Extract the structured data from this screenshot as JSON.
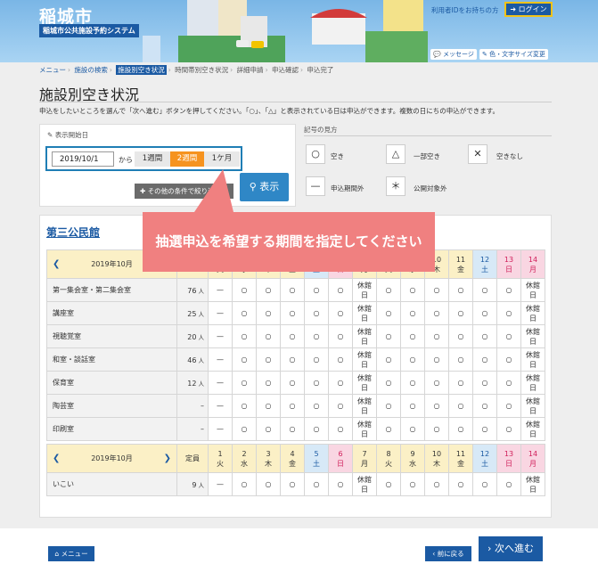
{
  "header": {
    "city_name": "稲城市",
    "system_name": "稲城市公共施設予約システム",
    "user_id_note": "利用者IDをお持ちの方",
    "login_label": "ログイン",
    "message_label": "メッセージ",
    "color_font_label": "色・文字サイズ変更"
  },
  "breadcrumb": {
    "items": [
      "メニュー",
      "施設の検索",
      "施設別空き状況",
      "時間帯別空き状況",
      "詳細申請",
      "申込確認",
      "申込完了"
    ]
  },
  "page": {
    "title": "施設別空き状況",
    "intro": "申込をしたいところを選んで「次へ進む」ボタンを押してください。「○」、「△」と表示されている日は申込ができます。複数の日にちの申込ができます。"
  },
  "start_panel": {
    "label": "表示開始日",
    "date_value": "2019/10/1",
    "kara": "から",
    "period_options": [
      "1週間",
      "2週間",
      "1ケ月"
    ],
    "selected_period": "2週間",
    "other_conditions": "その他の条件で絞り込む",
    "show_button": "表示"
  },
  "legend": {
    "title": "記号の見方",
    "items": [
      {
        "symbol": "○",
        "label": "空き"
      },
      {
        "symbol": "△",
        "label": "一部空き"
      },
      {
        "symbol": "✕",
        "label": "空きなし"
      },
      {
        "symbol": "—",
        "label": "申込期間外"
      },
      {
        "symbol": "＊",
        "label": "公開対象外"
      }
    ]
  },
  "callout": {
    "text": "抽選申込を希望する期間を指定してください"
  },
  "facility": {
    "name": "第三公民館",
    "month_label": "2019年10月",
    "capacity_header": "定員",
    "days": [
      {
        "d": "1",
        "w": "火",
        "t": "wk"
      },
      {
        "d": "2",
        "w": "水",
        "t": "wk"
      },
      {
        "d": "3",
        "w": "木",
        "t": "wk"
      },
      {
        "d": "4",
        "w": "金",
        "t": "wk"
      },
      {
        "d": "5",
        "w": "土",
        "t": "sat"
      },
      {
        "d": "6",
        "w": "日",
        "t": "sun"
      },
      {
        "d": "7",
        "w": "月",
        "t": "wk"
      },
      {
        "d": "8",
        "w": "火",
        "t": "wk"
      },
      {
        "d": "9",
        "w": "水",
        "t": "wk"
      },
      {
        "d": "10",
        "w": "木",
        "t": "wk"
      },
      {
        "d": "11",
        "w": "金",
        "t": "wk"
      },
      {
        "d": "12",
        "w": "土",
        "t": "sat"
      },
      {
        "d": "13",
        "w": "日",
        "t": "sun"
      },
      {
        "d": "14",
        "w": "月",
        "t": "sun"
      }
    ],
    "closed_label": "休館日",
    "rooms1": [
      {
        "name": "第一集会室・第二集会室",
        "cap": "76",
        "unit": "人",
        "cells": [
          "—",
          "○",
          "○",
          "○",
          "○",
          "○",
          "休館日",
          "○",
          "○",
          "○",
          "○",
          "○",
          "○",
          "休館日"
        ]
      },
      {
        "name": "講座室",
        "cap": "25",
        "unit": "人",
        "cells": [
          "—",
          "○",
          "○",
          "○",
          "○",
          "○",
          "休館日",
          "○",
          "○",
          "○",
          "○",
          "○",
          "○",
          "休館日"
        ]
      },
      {
        "name": "視聴覚室",
        "cap": "20",
        "unit": "人",
        "cells": [
          "—",
          "○",
          "○",
          "○",
          "○",
          "○",
          "休館日",
          "○",
          "○",
          "○",
          "○",
          "○",
          "○",
          "休館日"
        ]
      },
      {
        "name": "和室・談話室",
        "cap": "46",
        "unit": "人",
        "cells": [
          "—",
          "○",
          "○",
          "○",
          "○",
          "○",
          "休館日",
          "○",
          "○",
          "○",
          "○",
          "○",
          "○",
          "休館日"
        ]
      },
      {
        "name": "保育室",
        "cap": "12",
        "unit": "人",
        "cells": [
          "—",
          "○",
          "○",
          "○",
          "○",
          "○",
          "休館日",
          "○",
          "○",
          "○",
          "○",
          "○",
          "○",
          "休館日"
        ]
      },
      {
        "name": "陶芸室",
        "cap": "–",
        "unit": "",
        "cells": [
          "—",
          "○",
          "○",
          "○",
          "○",
          "○",
          "休館日",
          "○",
          "○",
          "○",
          "○",
          "○",
          "○",
          "休館日"
        ]
      },
      {
        "name": "印刷室",
        "cap": "–",
        "unit": "",
        "cells": [
          "—",
          "○",
          "○",
          "○",
          "○",
          "○",
          "休館日",
          "○",
          "○",
          "○",
          "○",
          "○",
          "○",
          "休館日"
        ]
      }
    ],
    "rooms2": [
      {
        "name": "いこい",
        "cap": "9",
        "unit": "人",
        "cells": [
          "—",
          "○",
          "○",
          "○",
          "○",
          "○",
          "休館日",
          "○",
          "○",
          "○",
          "○",
          "○",
          "○",
          "休館日"
        ]
      }
    ]
  },
  "footer": {
    "menu_label": "メニュー",
    "back_label": "前に戻る",
    "next_label": "次へ進む"
  },
  "colors": {
    "brand_blue": "#1b5aa3",
    "accent_orange": "#f6931f",
    "callout_pink": "#f08080",
    "header_yellow": "#fbf0c6"
  }
}
